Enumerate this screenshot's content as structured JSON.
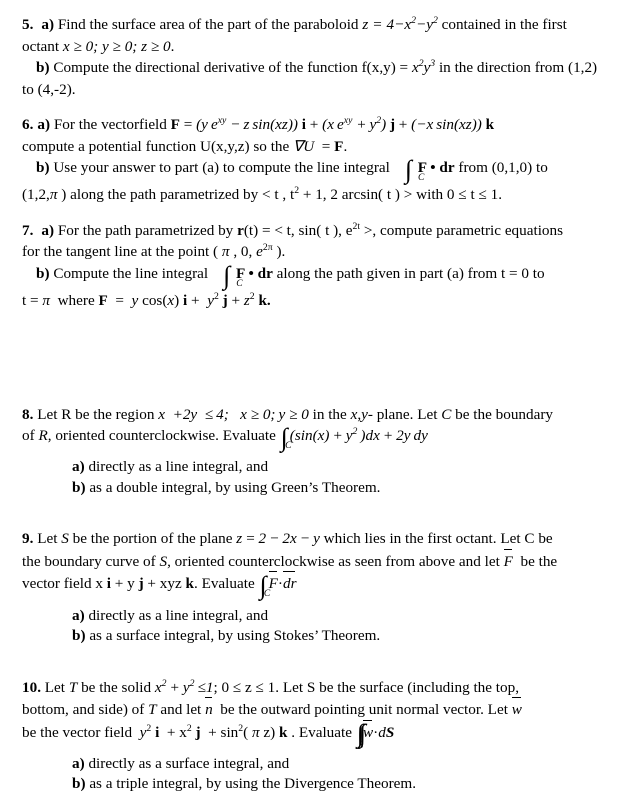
{
  "document": {
    "type": "math-exam-problems",
    "page_background": "#ffffff",
    "text_color": "#000000"
  },
  "problems": [
    {
      "number": "5.",
      "parts": [
        {
          "label": "a)",
          "text_before": "Find the surface area of the part of the paraboloid",
          "math1": "z = 4 − x² − y²",
          "text_mid": "contained in the first octant",
          "math2": "x ≥ 0; y ≥ 0; z ≥ 0",
          "text_after": "."
        },
        {
          "label": "b)",
          "text_before": "Compute the directional derivative of the function f(x,y) =",
          "math1": "x²y³",
          "text_after": "in the direction from (1,2) to (4,-2)."
        }
      ]
    },
    {
      "number": "6.",
      "parts": [
        {
          "label": "a)",
          "text_before": "For the vectorfield",
          "field_name": "F",
          "eq": "=",
          "component_i": "( y e^{xy} − z sin(xz) )",
          "unit_i": "i",
          "component_j": "( x e^{xy} + y² )",
          "unit_j": "j",
          "component_k": "( −x sin(xz) )",
          "unit_k": "k",
          "text_after": "compute a potential function U(x,y,z) so the ∇U = F."
        },
        {
          "label": "b)",
          "text_before": "Use your answer to part (a) to compute the line integral",
          "integral": "∫",
          "integral_sub": "C",
          "integrand": "F • dr",
          "text_mid": "from (0,1,0) to",
          "endpoint": "(1,2,π )",
          "text_after": "along the path parametrized by < t , t² + 1, 2 arcsin( t ) > with  0 ≤ t ≤ 1."
        }
      ]
    },
    {
      "number": "7.",
      "parts": [
        {
          "label": "a)",
          "text_before": "For the path parametrized by r(t) = < t, sin( t ), e",
          "exponent": "2t",
          "text_mid": ">, compute parametric equations for the tangent line at the point (",
          "point": "π , 0, e",
          "point_exponent": "2π",
          "text_after": ")."
        },
        {
          "label": "b)",
          "text_before": "Compute the line integral",
          "integral": "∫",
          "integral_sub": "C",
          "integrand": "F • dr",
          "text_mid": "along the path given in part (a) from t = 0 to",
          "text_after": "t = π where F =  y cos(x) i +  y² j + z² k."
        }
      ]
    },
    {
      "number": "8.",
      "statement_1": "Let R be the region",
      "region": "x  +2y  ≤ 4;   x ≥ 0; y ≥ 0",
      "statement_2": "in the x,y- plane. Let C be the boundary of R, oriented counterclockwise. Evaluate",
      "integral": "∫",
      "integral_sub": "C",
      "integrand": "(sin(x) + y² ) dx + 2y dy",
      "subitems": [
        {
          "label": "a)",
          "text": "directly as a line integral, and"
        },
        {
          "label": "b)",
          "text": "as a double integral, by using Green’s Theorem."
        }
      ]
    },
    {
      "number": "9.",
      "statement_1": "Let S be the portion of the plane",
      "plane": "z = 2 − 2x − y",
      "statement_2": "which lies in the first octant. Let C be the boundary curve of S, oriented counterclockwise as seen from above and let",
      "field_symbol": "F",
      "statement_3": "be the vector field x i + y j + xyz k. Evaluate",
      "integral": "∫",
      "integral_sub": "C",
      "integrand_vec": "F",
      "integrand_dot": "·",
      "integrand_dr": "dr",
      "subitems": [
        {
          "label": "a)",
          "text": "directly as a line integral, and"
        },
        {
          "label": "b)",
          "text": "as a surface integral, by using Stokes’ Theorem."
        }
      ]
    },
    {
      "number": "10.",
      "statement_1": "Let T be the solid",
      "solid": "x² + y² ≤ 1; 0 ≤ z ≤ 1",
      "statement_2": ". Let S be the surface (including the top, bottom, and side) of T and let",
      "normal_symbol": "n",
      "statement_3": "be the outward pointing unit normal vector. Let",
      "field_symbol": "w",
      "statement_4": "be the vector field",
      "field": "y² i + x² j + sin²( π z) k",
      "statement_5": ". Evaluate",
      "integral": "∬",
      "integral_sub": "S",
      "integrand_vec": "w",
      "integrand_dot": "·",
      "integrand_dS": "dS",
      "subitems": [
        {
          "label": "a)",
          "text": "directly as a surface integral, and"
        },
        {
          "label": "b)",
          "text": "as a triple integral, by using the Divergence Theorem."
        }
      ]
    }
  ]
}
